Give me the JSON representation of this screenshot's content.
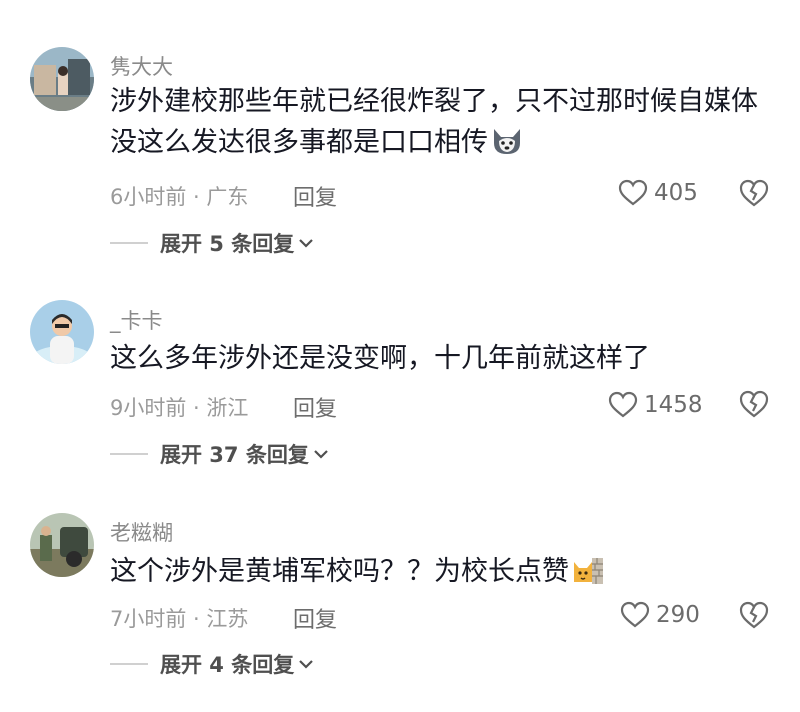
{
  "comments": [
    {
      "username": "隽大大",
      "text": "涉外建校那些年就已经很炸裂了，只不过那时候自媒体没这么发达很多事都是口口相传",
      "emoji": "husky-dog-emoji",
      "meta": "6小时前 · 广东",
      "reply_label": "回复",
      "likes": "405",
      "expand_label": "展开 5 条回复"
    },
    {
      "username": "_卡卡",
      "text": "这么多年涉外还是没变啊，十几年前就这样了",
      "meta": "9小时前 · 浙江",
      "reply_label": "回复",
      "likes": "1458",
      "expand_label": "展开 37 条回复"
    },
    {
      "username": "老糍糊",
      "text": "这个涉外是黄埔军校吗？？为校长点赞",
      "emoji": "cat-behind-wall-emoji",
      "meta": "7小时前 · 江苏",
      "reply_label": "回复",
      "likes": "290",
      "expand_label": "展开 4 条回复"
    }
  ],
  "colors": {
    "username": "#8a8a8a",
    "text": "#161823",
    "meta": "#9a9a9a",
    "icon": "#6b6b6b"
  }
}
